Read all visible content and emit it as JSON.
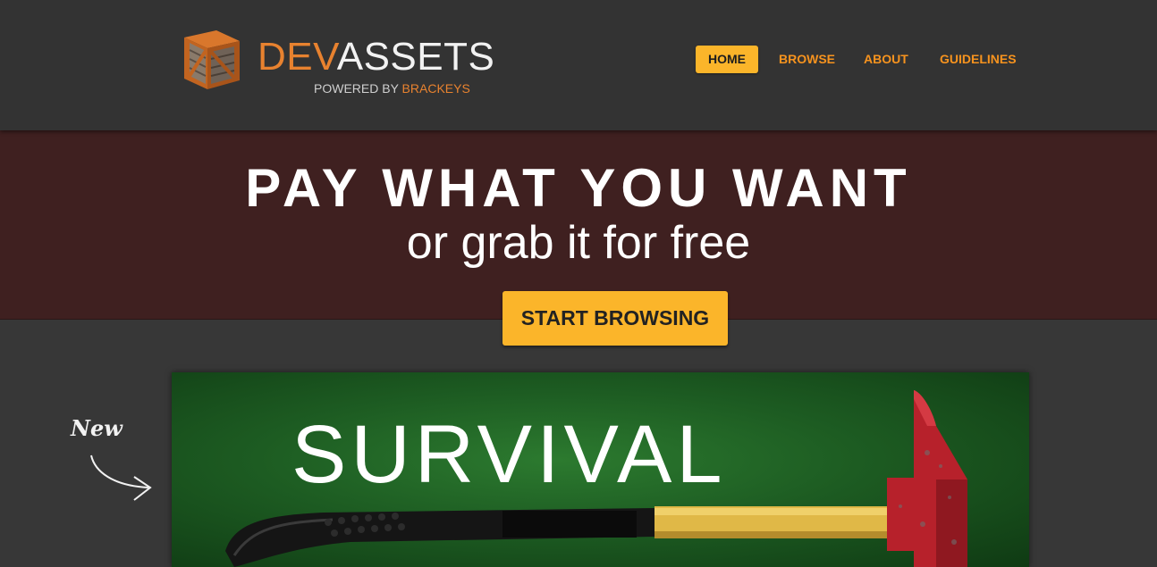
{
  "header": {
    "logo": {
      "brand_prefix": "DEV",
      "brand_suffix": "ASSETS",
      "powered_prefix": "POWERED BY",
      "powered_brand": "BRACKEYS"
    },
    "nav": [
      {
        "label": "HOME",
        "active": true
      },
      {
        "label": "BROWSE",
        "active": false
      },
      {
        "label": "ABOUT",
        "active": false
      },
      {
        "label": "GUIDELINES",
        "active": false
      }
    ]
  },
  "hero": {
    "title": "PAY WHAT YOU WANT",
    "subtitle": "or grab it for free",
    "cta_label": "START BROWSING"
  },
  "featured": {
    "marker": "New",
    "banner_title": "SURVIVAL",
    "icons": [
      "crate-logo-icon",
      "curved-arrow-icon",
      "fire-axe-image"
    ]
  },
  "colors": {
    "accent": "#fbb52a",
    "nav_link": "#f7931e",
    "brand_orange": "#e8822f",
    "header_bg": "#333333",
    "hero_bg": "#3f2020",
    "page_bg": "#373737",
    "banner_green": "#1d5c22"
  }
}
